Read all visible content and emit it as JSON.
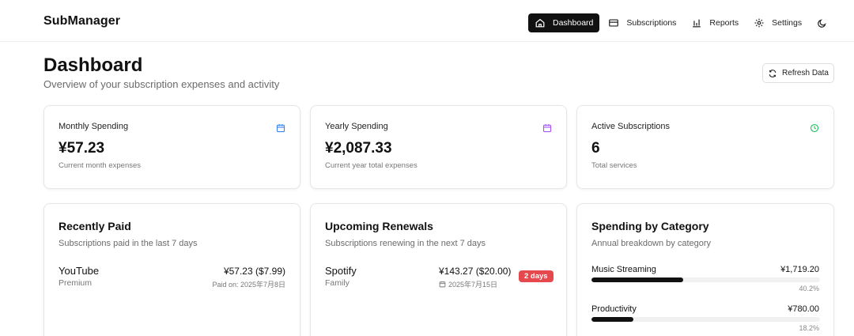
{
  "app": {
    "title": "SubManager"
  },
  "nav": {
    "items": [
      {
        "label": "Dashboard",
        "icon": "home-icon",
        "active": true
      },
      {
        "label": "Subscriptions",
        "icon": "credit-card-icon",
        "active": false
      },
      {
        "label": "Reports",
        "icon": "bar-chart-icon",
        "active": false
      },
      {
        "label": "Settings",
        "icon": "gear-icon",
        "active": false
      }
    ],
    "theme_toggle_icon": "moon-icon"
  },
  "header": {
    "title": "Dashboard",
    "subtitle": "Overview of your subscription expenses and activity",
    "refresh_label": "Refresh Data"
  },
  "stats": [
    {
      "label": "Monthly Spending",
      "value": "¥57.23",
      "desc": "Current month expenses",
      "icon": "calendar-icon",
      "color": "#3b82f6"
    },
    {
      "label": "Yearly Spending",
      "value": "¥2,087.33",
      "desc": "Current year total expenses",
      "icon": "calendar-icon",
      "color": "#a855f7"
    },
    {
      "label": "Active Subscriptions",
      "value": "6",
      "desc": "Total services",
      "icon": "clock-icon",
      "color": "#22c55e"
    }
  ],
  "recently_paid": {
    "title": "Recently Paid",
    "subtitle": "Subscriptions paid in the last 7 days",
    "items": [
      {
        "name": "YouTube",
        "plan": "Premium",
        "amount": "¥57.23 ($7.99)",
        "date": "Paid on: 2025年7月8日"
      }
    ]
  },
  "upcoming": {
    "title": "Upcoming Renewals",
    "subtitle": "Subscriptions renewing in the next 7 days",
    "items": [
      {
        "name": "Spotify",
        "plan": "Family",
        "amount": "¥143.27 ($20.00)",
        "date": "2025年7月15日",
        "badge": "2 days",
        "badge_color": "#e5484d"
      }
    ]
  },
  "categories": {
    "title": "Spending by Category",
    "subtitle": "Annual breakdown by category",
    "items": [
      {
        "name": "Music Streaming",
        "amount": "¥1,719.20",
        "percent": "40.2%",
        "fraction": 0.402
      },
      {
        "name": "Productivity",
        "amount": "¥780.00",
        "percent": "18.2%",
        "fraction": 0.182
      }
    ]
  }
}
